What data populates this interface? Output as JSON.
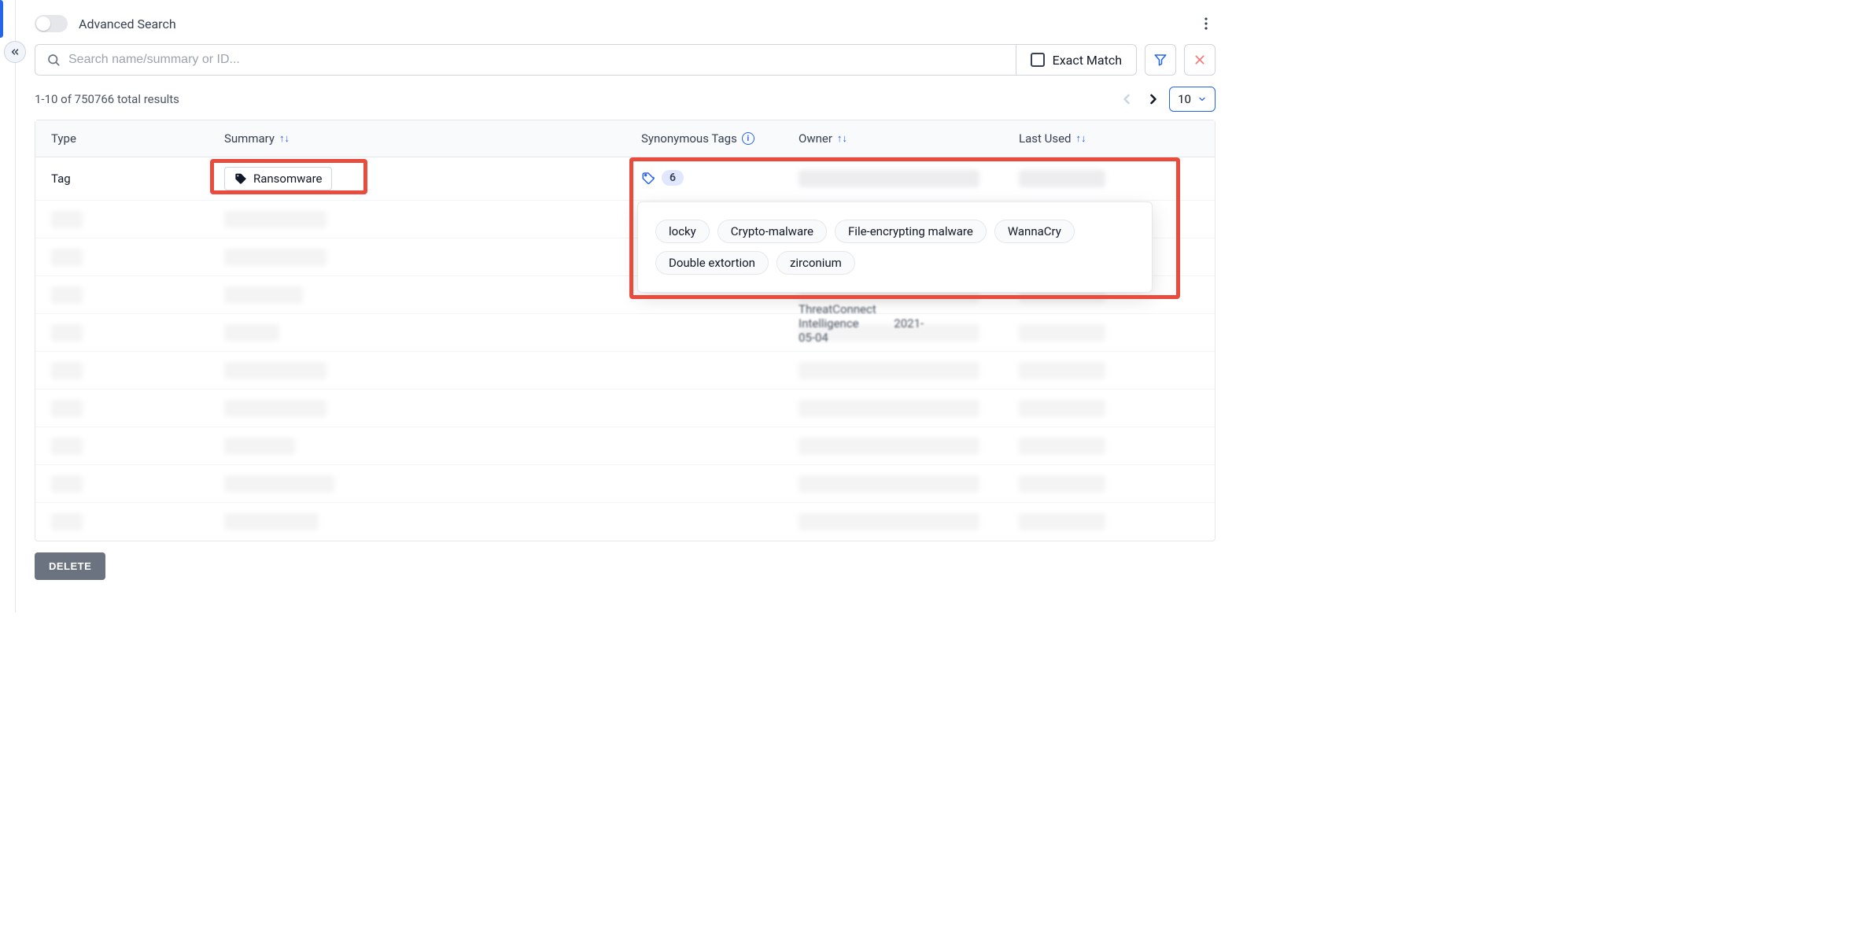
{
  "header": {
    "advanced_label": "Advanced Search"
  },
  "search": {
    "placeholder": "Search name/summary or ID...",
    "exact_label": "Exact Match"
  },
  "results": {
    "summary_text": "1-10 of 750766 total results",
    "page_size": "10"
  },
  "columns": {
    "type": "Type",
    "summary": "Summary",
    "syn_tags": "Synonymous Tags",
    "owner": "Owner",
    "last_used": "Last Used"
  },
  "row0": {
    "type": "Tag",
    "summary": "Ransomware",
    "syn_count": "6",
    "synonyms": [
      "locky",
      "Crypto-malware",
      "File-encrypting malware",
      "WannaCry",
      "Double extortion",
      "zirconium"
    ]
  },
  "peek": {
    "owner": "ThreatConnect Intelligence",
    "date": "2021-05-04"
  },
  "actions": {
    "delete": "DELETE"
  }
}
